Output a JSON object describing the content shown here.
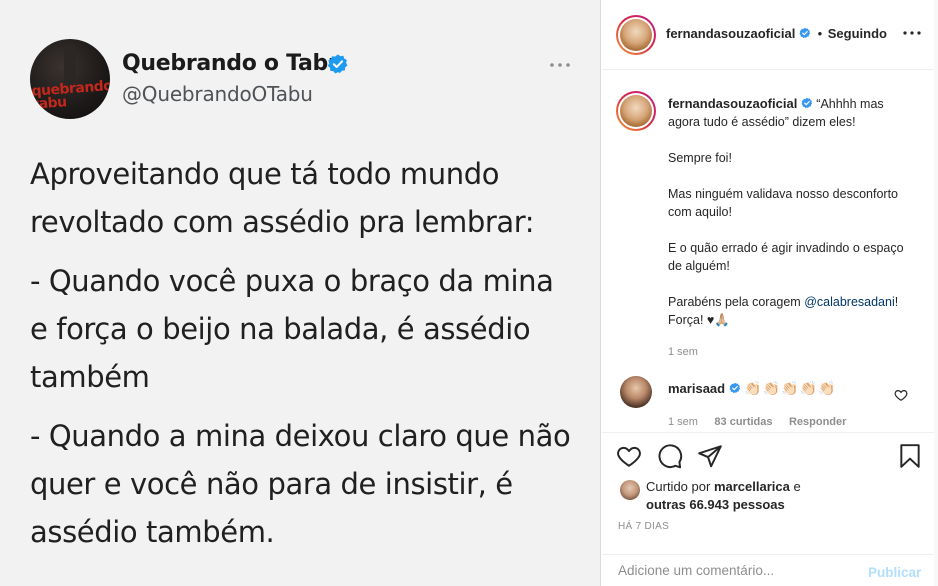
{
  "tweet": {
    "name": "Quebrando o Tabu",
    "handle": "@QuebrandoOTabu",
    "avatar_logo_text_1": "quebrando",
    "avatar_logo_text_2": "tabu",
    "paragraphs": [
      [
        "Aproveitando que tá todo mundo",
        "revoltado com assédio pra lembrar:"
      ],
      [
        "- Quando você puxa o braço da mina",
        "e força o beijo na balada, é assédio",
        "também"
      ],
      [
        "- Quando a mina deixou claro que não",
        "quer e você não para de insistir, é",
        "assédio também."
      ]
    ]
  },
  "header": {
    "username": "fernandasouzaoficial",
    "separator": "•",
    "follow_status": "Seguindo"
  },
  "caption": {
    "username": "fernandasouzaoficial",
    "first_line": "“Ahhhh mas agora tudo é assédio” dizem eles!",
    "p2": "Sempre foi!",
    "p3": "Mas ninguém validava nosso desconforto com aquilo!",
    "p4": "E o quão errado é agir invadindo o espaço de alguém!",
    "p5_prefix": "Parabéns pela coragem",
    "p5_mention": "@calabresadani",
    "p5_suffix": "! Força! ♥🙏🏼",
    "time": "1 sem"
  },
  "comment": {
    "username": "marisaad",
    "text": "👏🏻👏🏻👏🏻👏🏻👏🏻",
    "time": "1 sem",
    "likes": "83 curtidas",
    "reply": "Responder"
  },
  "likes": {
    "prefix": "Curtido por",
    "user": "marcellarica",
    "suffix": "e",
    "others": "outras 66.943 pessoas"
  },
  "date": "HÁ 7 DIAS",
  "add_comment": {
    "placeholder": "Adicione um comentário...",
    "publish": "Publicar"
  },
  "colors": {
    "verified": "#3897f0",
    "mention": "#00376b",
    "muted": "#8e8e8e",
    "publish_disabled": "#b2dffc"
  },
  "icons": [
    "verified-badge-icon",
    "more-options-icon",
    "heart-icon",
    "comment-icon",
    "share-icon",
    "bookmark-icon"
  ]
}
